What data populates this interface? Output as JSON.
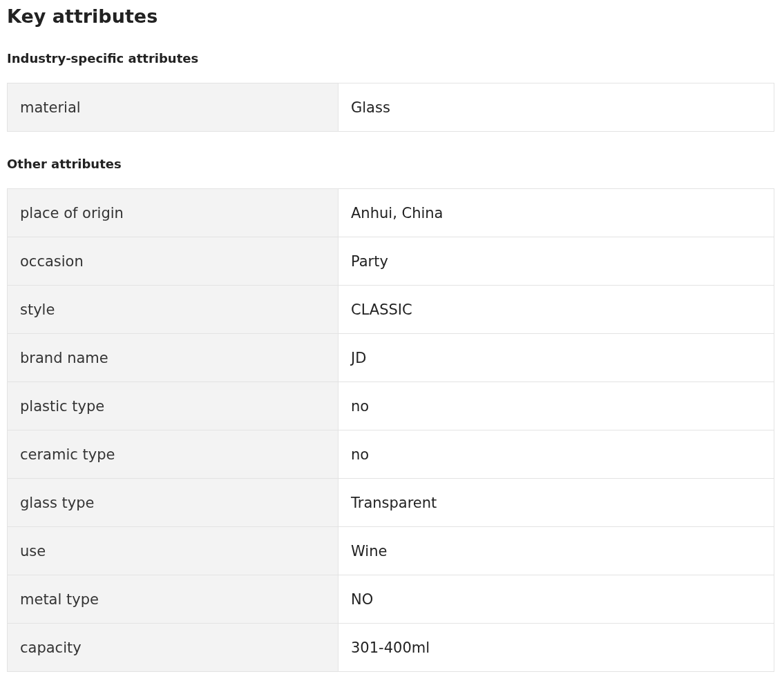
{
  "title": "Key attributes",
  "sections": [
    {
      "heading": "Industry-specific attributes",
      "rows": [
        {
          "name": "material",
          "value": "Glass"
        }
      ]
    },
    {
      "heading": "Other attributes",
      "rows": [
        {
          "name": "place of origin",
          "value": "Anhui, China"
        },
        {
          "name": "occasion",
          "value": "Party"
        },
        {
          "name": "style",
          "value": "CLASSIC"
        },
        {
          "name": "brand name",
          "value": "JD"
        },
        {
          "name": "plastic type",
          "value": "no"
        },
        {
          "name": "ceramic type",
          "value": "no"
        },
        {
          "name": "glass type",
          "value": "Transparent"
        },
        {
          "name": "use",
          "value": "Wine"
        },
        {
          "name": "metal type",
          "value": "NO"
        },
        {
          "name": "capacity",
          "value": "301-400ml"
        }
      ]
    }
  ]
}
